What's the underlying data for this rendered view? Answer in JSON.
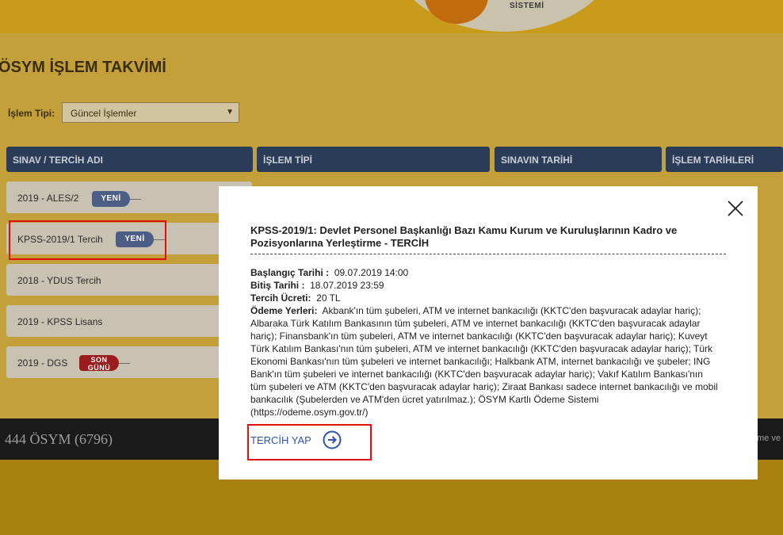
{
  "brand": {
    "logo_text": "SİSTEMİ"
  },
  "page": {
    "title": "ÖSYM İŞLEM TAKVİMİ",
    "filter": {
      "label": "İşlem Tipi:",
      "selected": "Güncel İşlemler"
    },
    "columns": [
      "SINAV / TERCİH ADI",
      "İŞLEM TİPİ",
      "SINAVIN TARİHİ",
      "İŞLEM TARİHLERİ"
    ],
    "rows": [
      {
        "name": "2019 - ALES/2",
        "tag": "YENİ"
      },
      {
        "name": "KPSS-2019/1 Tercih",
        "tag": "YENİ"
      },
      {
        "name": "2018 - YDUS Tercih",
        "tag": ""
      },
      {
        "name": "2019 - KPSS Lisans",
        "tag": ""
      },
      {
        "name": "2019 - DGS",
        "tag_line1": "SON",
        "tag_line2": "GÜNÜ"
      }
    ]
  },
  "footer": {
    "phone": "444 ÖSYM (6796)",
    "right_text": "me ve Y"
  },
  "modal": {
    "title": "KPSS-2019/1: Devlet Personel Başkanlığı Bazı Kamu Kurum ve Kuruluşlarının Kadro ve Pozisyonlarına Yerleştirme - TERCİH",
    "start_label": "Başlangıç Tarihi :",
    "start_value": "09.07.2019 14:00",
    "end_label": "Bitiş Tarihi :",
    "end_value": "18.07.2019 23:59",
    "fee_label": "Tercih Ücreti:",
    "fee_value": "20 TL",
    "payment_label": "Ödeme Yerleri:",
    "payment_value": "Akbank'ın tüm şubeleri, ATM ve internet bankacılığı (KKTC'den başvuracak adaylar hariç); Albaraka Türk Katılım Bankasının tüm şubeleri, ATM ve internet bankacılığı (KKTC'den başvuracak adaylar hariç); Finansbank'ın tüm şubeleri, ATM ve internet bankacılığı (KKTC'den başvuracak adaylar hariç); Kuveyt Türk Katılım Bankası'nın tüm şubeleri, ATM ve internet bankacılığı (KKTC'den başvuracak adaylar hariç); Türk Ekonomi Bankası'nın tüm şubeleri ve internet bankacılığı; Halkbank ATM, internet bankacılığı ve şubeler; ING Bank'ın tüm şubeleri ve internet bankacılığı (KKTC'den başvuracak adaylar hariç); Vakıf Katılım Bankası'nın tüm şubeleri ve ATM (KKTC'den başvuracak adaylar hariç); Ziraat Bankası sadece internet bankacılığı ve mobil bankacılık (Şubelerden ve ATM'den ücret yatırılmaz.); ÖSYM Kartlı Ödeme Sistemi (https://odeme.osym.gov.tr/)",
    "cta_label": "TERCİH YAP"
  },
  "colors": {
    "highlight": "#e01010",
    "header_bg": "#2b3c58",
    "link": "#2f55a4",
    "tag_new": "#4c5d86",
    "tag_last": "#9a1c1c"
  }
}
